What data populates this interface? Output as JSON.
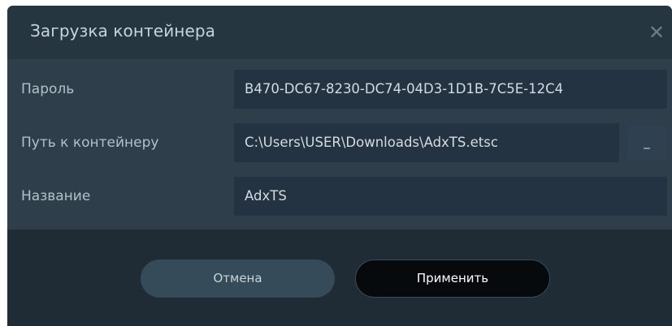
{
  "dialog": {
    "title": "Загрузка контейнера",
    "close_icon": "close-icon",
    "close_glyph": "✕"
  },
  "fields": {
    "password": {
      "label": "Пароль",
      "value": "B470-DC67-8230-DC74-04D3-1D1B-7C5E-12C4"
    },
    "path": {
      "label": "Путь к контейнеру",
      "value": "C:\\Users\\USER\\Downloads\\AdxTS.etsc",
      "browse_label": "_"
    },
    "name": {
      "label": "Название",
      "value": "AdxTS"
    }
  },
  "buttons": {
    "cancel_label": "Отмена",
    "apply_label": "Применить"
  },
  "colors": {
    "title_bar": "#263641",
    "body": "#2e3f4b",
    "field_bg": "#233341",
    "footer": "#1f2b35",
    "cancel_bg": "#354b5a",
    "apply_bg": "#070a0d"
  }
}
